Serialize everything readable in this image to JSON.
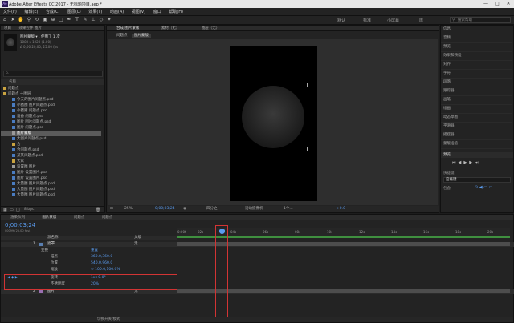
{
  "window": {
    "title": "Adobe After Effects CC 2017 - 无标题项目.aep *",
    "logo": "Ae",
    "minimize": "—",
    "maximize": "□",
    "close": "✕"
  },
  "menu": [
    "文件(F)",
    "编辑(E)",
    "合成(C)",
    "图层(L)",
    "效果(T)",
    "动画(A)",
    "视图(V)",
    "窗口",
    "帮助(H)"
  ],
  "toolbar": {
    "workspaces": [
      "默认",
      "标准",
      "小屏幕",
      "库"
    ],
    "search": "搜索帮助"
  },
  "project": {
    "tabs": [
      "项目",
      "效果控件 图片"
    ],
    "selected_name": "图片蒙版 ▾ , 使用了 1 次",
    "info1": "1080 x 1920 (1.00)",
    "info2": "Δ 0;00;20;00, 25.00 fps",
    "search": "ρ.",
    "col_name": "名称",
    "items": [
      "问题点",
      "问题点 十图层",
      "今天的图片问题点.psd",
      "小猪图 图片问题点.psd",
      "小猪猪 问题点.psd",
      "设备 问题点.psd",
      "图片 图片问题点.psd",
      "图片 问题点.psd",
      "图片蒙版",
      "大图片问题点.psd",
      "合",
      "合问题点.psd",
      "某某问题点.psd",
      "大家",
      "设置图 图片",
      "图片 设置图片.psd",
      "图片 设置图片.psd",
      "大量图 图片问题点.psd",
      "大量图 图片问题点.psd",
      "大量图 图片问题点.psd"
    ],
    "bpc": "8 bpc"
  },
  "composition": {
    "tabs": [
      "合成 图片蒙版",
      "素材（无）",
      "图层（无）"
    ],
    "subtabs": [
      "问题点",
      "图片蒙版"
    ],
    "footer": {
      "zoom": "25%",
      "time": "0;00;03;24",
      "quality": "四分之一",
      "camera": "活动摄像机",
      "view": "1个...",
      "exposure": "+0.0"
    }
  },
  "right_panel": {
    "items": [
      "信息",
      "音频",
      "预览",
      "效果和预设",
      "对齐",
      "字符",
      "段落",
      "跟踪器",
      "画笔",
      "绘画",
      "动态草图",
      "平滑器",
      "摇摆器",
      "蒙版插值"
    ],
    "preview_title": "预览",
    "shortcut_label": "快捷键",
    "shortcut_value": "空格键",
    "include_label": "包含"
  },
  "timeline": {
    "tabs": [
      "渲染队列",
      "图片蒙版",
      "问题点",
      "问题点"
    ],
    "timecode": "0;00;03;24",
    "timecode_sub": "00099 (25.00 fps)",
    "headers": {
      "name": "源名称",
      "parent": "父级"
    },
    "ruler": [
      "0:00f",
      "02s",
      "04s",
      "06s",
      "08s",
      "10s",
      "12s",
      "14s",
      "16s",
      "18s",
      "20s"
    ],
    "layers": [
      {
        "num": "1",
        "name": "遮罩",
        "parent": "无"
      },
      {
        "name": "变换",
        "value": "重置"
      },
      {
        "name": "锚点",
        "value": "360.0,360.0"
      },
      {
        "name": "位置",
        "value": "540.0,960.0"
      },
      {
        "name": "缩放",
        "value": "∞ 100.0,100.0%"
      },
      {
        "name": "旋转",
        "value": "1x+0.0°"
      },
      {
        "name": "不透明度",
        "value": "20%"
      },
      {
        "num": "2",
        "name": "图片",
        "parent": "无"
      }
    ],
    "footer": "切换开关/模式"
  }
}
